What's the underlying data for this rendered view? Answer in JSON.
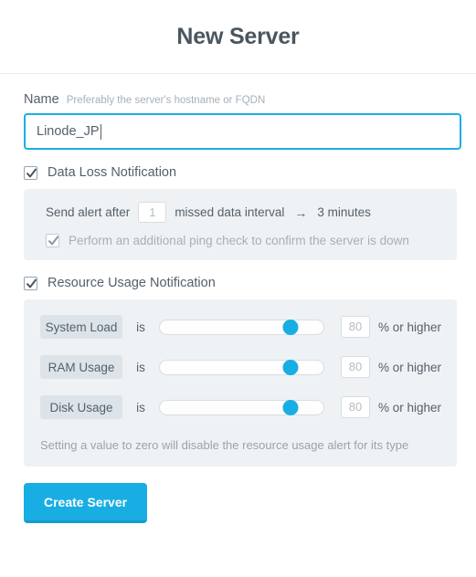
{
  "header": {
    "title": "New Server"
  },
  "name_field": {
    "label": "Name",
    "hint": "Preferably the server's hostname or FQDN",
    "value": "Linode_JP",
    "placeholder": ""
  },
  "data_loss": {
    "checkbox_label": "Data Loss Notification",
    "checked": true,
    "send_alert_prefix": "Send alert after",
    "interval_value": "1",
    "interval_suffix": "missed data interval",
    "arrow": "→",
    "interval_result": "3 minutes",
    "ping_check_label": "Perform an additional ping check to confirm the server is down",
    "ping_check_checked": true
  },
  "resource_usage": {
    "checkbox_label": "Resource Usage Notification",
    "checked": true,
    "is_word": "is",
    "suffix": "% or higher",
    "note": "Setting a value to zero will disable the resource usage alert for its type",
    "rows": [
      {
        "label": "System Load",
        "value": "80",
        "percent": 80
      },
      {
        "label": "RAM Usage",
        "value": "80",
        "percent": 80
      },
      {
        "label": "Disk Usage",
        "value": "80",
        "percent": 80
      }
    ]
  },
  "actions": {
    "create_label": "Create Server"
  },
  "colors": {
    "accent": "#19aee3",
    "accent_dark": "#139ccd",
    "panel_bg": "#eef2f4",
    "pill_bg": "#dde4e9",
    "text": "#55606b",
    "muted": "#a7b0b8"
  }
}
